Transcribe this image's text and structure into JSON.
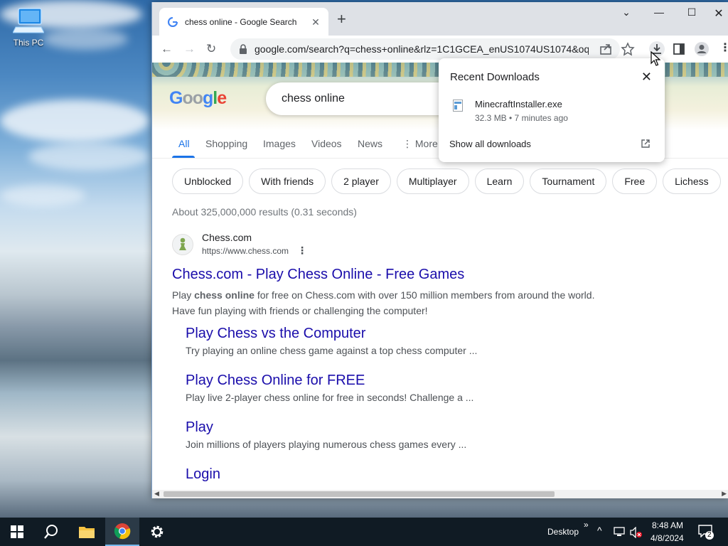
{
  "desktop": {
    "icon_label": "This PC"
  },
  "browser": {
    "tab_title": "chess online - Google Search",
    "url": "google.com/search?q=chess+online&rlz=1C1GCEA_enUS1074US1074&oq...",
    "window_controls": [
      "chevron-down",
      "minimize",
      "maximize",
      "close"
    ]
  },
  "search": {
    "query": "chess online",
    "logo_letters": [
      "G",
      "o",
      "o",
      "g",
      "l",
      "e"
    ],
    "logo_colors": [
      "#4285f4",
      "#9aa0a6",
      "#9aa0a6",
      "#4285f4",
      "#34a853",
      "#ea4335"
    ],
    "tabs": [
      {
        "label": "All",
        "active": true
      },
      {
        "label": "Shopping",
        "active": false
      },
      {
        "label": "Images",
        "active": false
      },
      {
        "label": "Videos",
        "active": false
      },
      {
        "label": "News",
        "active": false
      },
      {
        "label": "More",
        "active": false
      }
    ],
    "chips": [
      "Unblocked",
      "With friends",
      "2 player",
      "Multiplayer",
      "Learn",
      "Tournament",
      "Free",
      "Lichess"
    ],
    "stats": "About 325,000,000 results (0.31 seconds)"
  },
  "result": {
    "site_name": "Chess.com",
    "site_url": "https://www.chess.com",
    "title": "Chess.com - Play Chess Online - Free Games",
    "snippet_prefix": "Play ",
    "snippet_bold": "chess online",
    "snippet_suffix": " for free on Chess.com with over 150 million members from around the world.",
    "snippet_line2": "Have fun playing with friends or challenging the computer!",
    "sitelinks": [
      {
        "title": "Play Chess vs the Computer",
        "snippet": "Try playing an online chess game against a top chess computer ..."
      },
      {
        "title": "Play Chess Online for FREE",
        "snippet": "Play live 2-player chess online for free in seconds! Challenge a ..."
      },
      {
        "title": "Play",
        "snippet": "Join millions of players playing numerous chess games every ..."
      },
      {
        "title": "Login",
        "snippet": ""
      }
    ]
  },
  "downloads": {
    "header": "Recent Downloads",
    "file_name": "MinecraftInstaller.exe",
    "file_meta": "32.3 MB • 7 minutes ago",
    "show_all": "Show all downloads"
  },
  "taskbar": {
    "desktop_label": "Desktop",
    "time": "8:48 AM",
    "date": "4/8/2024",
    "notification_count": "2"
  }
}
